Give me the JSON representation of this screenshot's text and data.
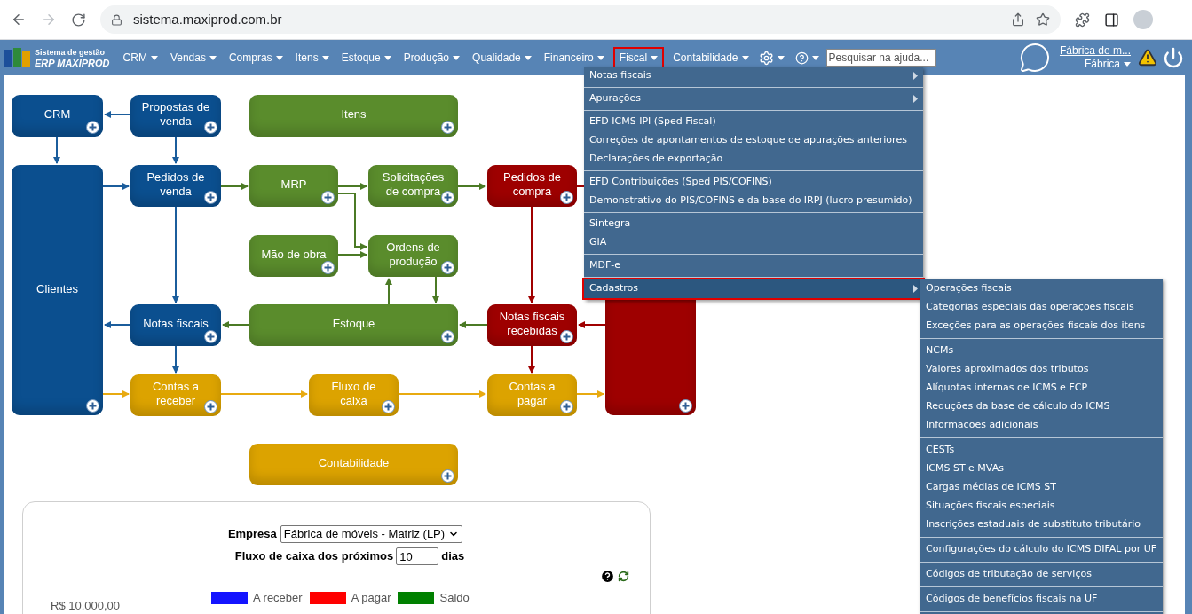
{
  "browser": {
    "url": "sistema.maxiprod.com.br"
  },
  "nav": {
    "logo_line1": "Sistema de gestão",
    "logo_line2": "ERP MAXIPROD",
    "items": [
      {
        "label": "CRM",
        "annotated": false
      },
      {
        "label": "Vendas",
        "annotated": false
      },
      {
        "label": "Compras",
        "annotated": false
      },
      {
        "label": "Itens",
        "annotated": false
      },
      {
        "label": "Estoque",
        "annotated": false
      },
      {
        "label": "Produção",
        "annotated": false
      },
      {
        "label": "Qualidade",
        "annotated": false
      },
      {
        "label": "Financeiro",
        "annotated": false
      },
      {
        "label": "Fiscal",
        "annotated": true
      },
      {
        "label": "Contabilidade",
        "annotated": false
      }
    ],
    "search": {
      "placeholder": "Pesquisar na ajuda..."
    },
    "company_link": "Fábrica de m...",
    "unit": "Fábrica"
  },
  "fiscal_menu": {
    "groups": [
      [
        {
          "label": "Notas fiscais",
          "submenu": true,
          "selected": false,
          "annotated": false
        }
      ],
      [
        {
          "label": "Apurações",
          "submenu": true,
          "selected": false,
          "annotated": false
        }
      ],
      [
        {
          "label": "EFD ICMS IPI (Sped Fiscal)",
          "submenu": false,
          "selected": false,
          "annotated": false
        },
        {
          "label": "Correções de apontamentos de estoque de apurações anteriores",
          "submenu": false,
          "selected": false,
          "annotated": false
        },
        {
          "label": "Declarações de exportação",
          "submenu": false,
          "selected": false,
          "annotated": false
        }
      ],
      [
        {
          "label": "EFD Contribuições (Sped PIS/COFINS)",
          "submenu": false,
          "selected": false,
          "annotated": false
        },
        {
          "label": "Demonstrativo do PIS/COFINS e da base do IRPJ (lucro presumido)",
          "submenu": false,
          "selected": false,
          "annotated": false
        }
      ],
      [
        {
          "label": "Sintegra",
          "submenu": false,
          "selected": false,
          "annotated": false
        },
        {
          "label": "GIA",
          "submenu": false,
          "selected": false,
          "annotated": false
        }
      ],
      [
        {
          "label": "MDF-e",
          "submenu": false,
          "selected": false,
          "annotated": false
        }
      ],
      [
        {
          "label": "Cadastros",
          "submenu": true,
          "selected": true,
          "annotated": true
        }
      ]
    ]
  },
  "cadastros_submenu": {
    "groups": [
      [
        "Operações fiscais",
        "Categorias especiais das operações fiscais",
        "Exceções para as operações fiscais dos itens"
      ],
      [
        "NCMs",
        "Valores aproximados dos tributos",
        "Alíquotas internas de ICMS e FCP",
        "Reduções da base de cálculo do ICMS",
        "Informações adicionais"
      ],
      [
        "CESTs",
        "ICMS ST e MVAs",
        "Cargas médias de ICMS ST",
        "Situações fiscais especiais",
        "Inscrições estaduais de substituto tributário"
      ],
      [
        "Configurações do cálculo do ICMS DIFAL por UF"
      ],
      [
        "Códigos de tributação de serviços"
      ],
      [
        "Códigos de benefícios fiscais na UF"
      ]
    ]
  },
  "diagram": {
    "nodes": [
      {
        "label": "CRM",
        "color": "#0b4f8f"
      },
      {
        "label": "Propostas de venda",
        "color": "#0b4f8f"
      },
      {
        "label": "Itens",
        "color": "#5a8c2c"
      },
      {
        "label": "Clientes",
        "color": "#0b4f8f"
      },
      {
        "label": "Pedidos de venda",
        "color": "#0b4f8f"
      },
      {
        "label": "MRP",
        "color": "#5a8c2c"
      },
      {
        "label": "Solicitações de compra",
        "color": "#5a8c2c"
      },
      {
        "label": "Pedidos de compra",
        "color": "#9e0000"
      },
      {
        "color": "#9e0000"
      },
      {
        "label": "Mão de obra",
        "color": "#5a8c2c"
      },
      {
        "label": "Ordens de produção",
        "color": "#5a8c2c"
      },
      {
        "label": "Notas fiscais",
        "color": "#0b4f8f"
      },
      {
        "label": "Estoque",
        "color": "#5a8c2c"
      },
      {
        "label": "Notas fiscais recebidas",
        "color": "#9e0000"
      },
      {
        "label": "Contas a receber",
        "color": "#dca300"
      },
      {
        "label": "Fluxo de caixa",
        "color": "#dca300"
      },
      {
        "label": "Contas a pagar",
        "color": "#dca300"
      },
      {
        "label": "Contabilidade",
        "color": "#dca300"
      }
    ]
  },
  "cash_flow": {
    "company_label": "Empresa",
    "company_value": "Fábrica de móveis - Matriz (LP)",
    "days_label": "Fluxo de caixa dos próximos",
    "days_value": "10",
    "days_unit": "dias",
    "legend": [
      {
        "label": "A receber",
        "color": "#1414ff"
      },
      {
        "label": "A pagar",
        "color": "#ff0000"
      },
      {
        "label": "Saldo",
        "color": "#008000"
      }
    ],
    "y_axis_label": "R$ 10.000,00"
  }
}
